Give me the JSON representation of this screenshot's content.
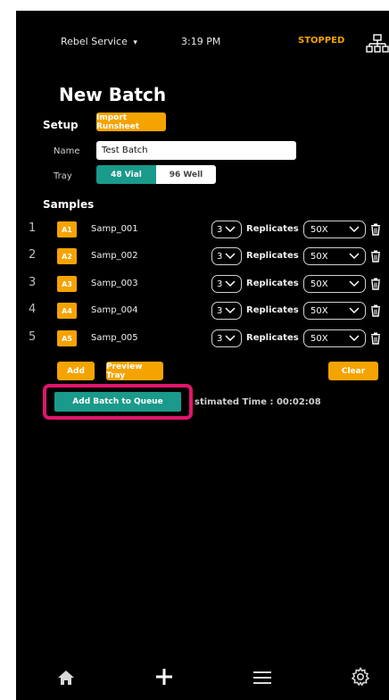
{
  "status_bar": {
    "service_label": "Rebel Service",
    "service_chevron": "▾",
    "time": "3:19 PM",
    "status": "STOPPED",
    "network_icon": "network-icon"
  },
  "page": {
    "title": "New Batch"
  },
  "setup": {
    "heading": "Setup",
    "import_button": "Import Runsheet",
    "name_label": "Name",
    "name_value": "Test Batch",
    "tray_label": "Tray",
    "tray_options": [
      "48 Vial",
      "96 Well"
    ],
    "tray_selected": "48 Vial"
  },
  "samples": {
    "heading": "Samples",
    "replicates_label": "Replicates",
    "rows": [
      {
        "num": "1",
        "well": "A1",
        "name": "Samp_001",
        "replicates": "3",
        "dilution": "50X"
      },
      {
        "num": "2",
        "well": "A2",
        "name": "Samp_002",
        "replicates": "3",
        "dilution": "50X"
      },
      {
        "num": "3",
        "well": "A3",
        "name": "Samp_003",
        "replicates": "3",
        "dilution": "50X"
      },
      {
        "num": "4",
        "well": "A4",
        "name": "Samp_004",
        "replicates": "3",
        "dilution": "50X"
      },
      {
        "num": "5",
        "well": "A5",
        "name": "Samp_005",
        "replicates": "3",
        "dilution": "50X"
      }
    ]
  },
  "actions": {
    "add_label": "Add",
    "preview_label": "Preview Tray",
    "clear_label": "Clear",
    "queue_label": "Add Batch to Queue",
    "estimated_time": "stimated Time : 00:02:08"
  },
  "bottom_nav": {
    "items": [
      "home-icon",
      "plus-icon",
      "menu-icon",
      "settings-icon"
    ]
  },
  "colors": {
    "accent_orange": "#f5a300",
    "teal": "#1a9a8a",
    "highlight_pink": "#e0166a",
    "background": "#000000"
  }
}
